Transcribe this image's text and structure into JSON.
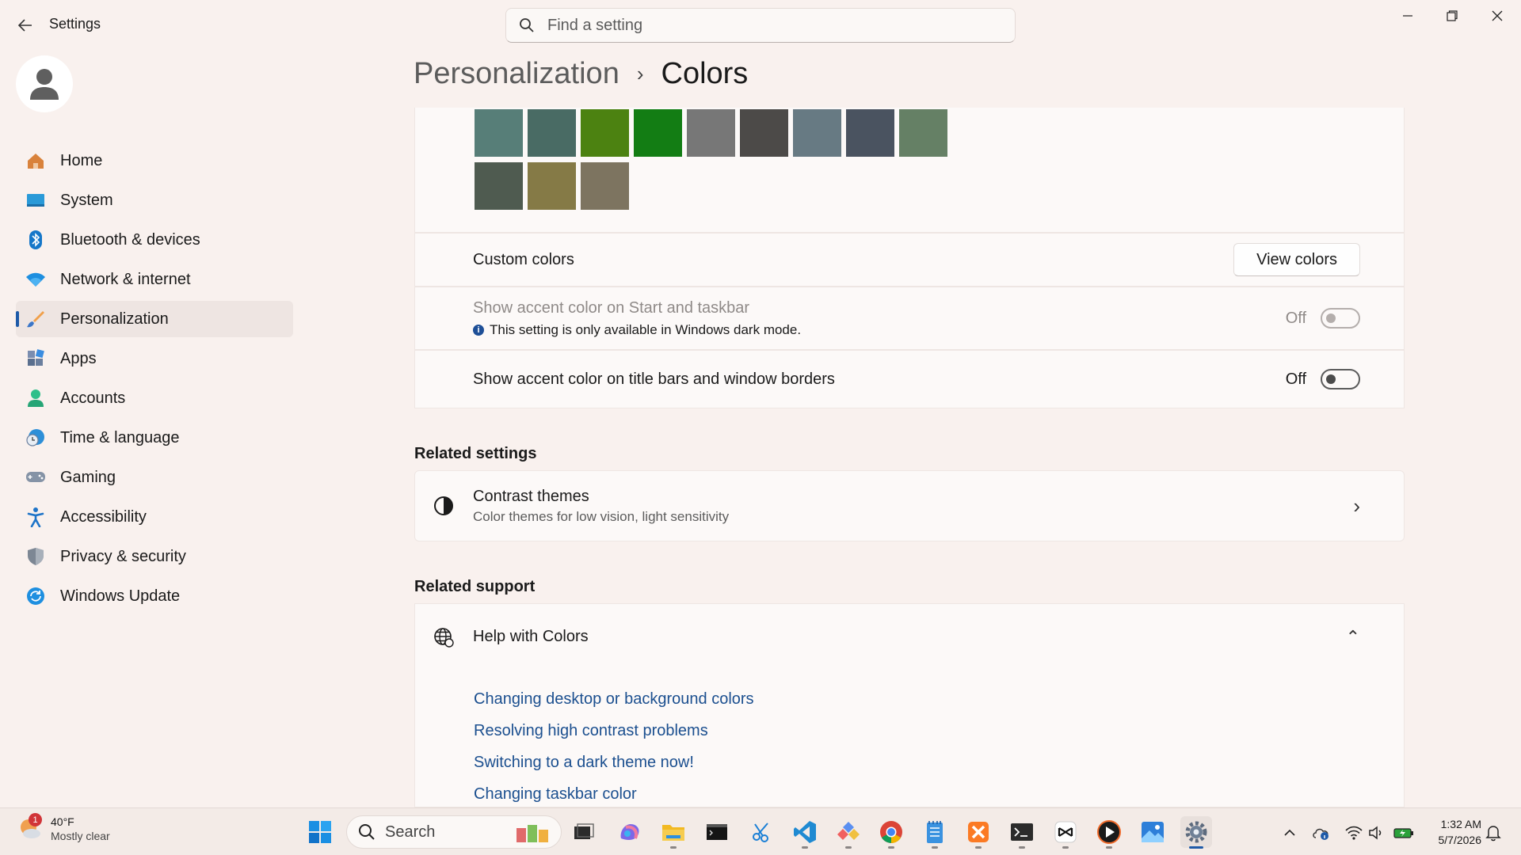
{
  "app": {
    "title": "Settings"
  },
  "search": {
    "placeholder": "Find a setting"
  },
  "window_controls": {
    "minimize": "—",
    "restore": "❐",
    "close": "✕"
  },
  "sidebar": {
    "items": [
      {
        "label": "Home",
        "icon": "home-icon"
      },
      {
        "label": "System",
        "icon": "system-icon"
      },
      {
        "label": "Bluetooth & devices",
        "icon": "bluetooth-icon"
      },
      {
        "label": "Network & internet",
        "icon": "wifi-icon"
      },
      {
        "label": "Personalization",
        "icon": "brush-icon",
        "active": true
      },
      {
        "label": "Apps",
        "icon": "apps-icon"
      },
      {
        "label": "Accounts",
        "icon": "accounts-icon"
      },
      {
        "label": "Time & language",
        "icon": "clock-globe-icon"
      },
      {
        "label": "Gaming",
        "icon": "gamepad-icon"
      },
      {
        "label": "Accessibility",
        "icon": "accessibility-icon"
      },
      {
        "label": "Privacy & security",
        "icon": "shield-icon"
      },
      {
        "label": "Windows Update",
        "icon": "update-icon"
      }
    ]
  },
  "header": {
    "parent": "Personalization",
    "separator": "›",
    "current": "Colors"
  },
  "swatches": {
    "row1": [
      "#577e78",
      "#496b64",
      "#4c8211",
      "#137d14",
      "#777777",
      "#4c4a48",
      "#677a83",
      "#4a5360",
      "#658065"
    ],
    "row2": [
      "#4f5b50",
      "#857a46",
      "#7d7460"
    ]
  },
  "custom_colors": {
    "label": "Custom colors",
    "button": "View colors"
  },
  "accent_start": {
    "label": "Show accent color on Start and taskbar",
    "note": "This setting is only available in Windows dark mode.",
    "state": "Off",
    "on": false,
    "disabled": true
  },
  "accent_titlebars": {
    "label": "Show accent color on title bars and window borders",
    "state": "Off",
    "on": false
  },
  "related_settings": {
    "title": "Related settings",
    "contrast": {
      "title": "Contrast themes",
      "subtitle": "Color themes for low vision, light sensitivity",
      "chevron": "›"
    }
  },
  "related_support": {
    "title": "Related support",
    "help_title": "Help with Colors",
    "chevron": "⌃",
    "links": [
      "Changing desktop or background colors",
      "Resolving high contrast problems",
      "Switching to a dark theme now!",
      "Changing taskbar color"
    ]
  },
  "taskbar": {
    "weather": {
      "temp": "40°F",
      "condition": "Mostly clear",
      "badge": "1"
    },
    "search_label": "Search",
    "apps": [
      "file-explorer-icon",
      "terminal-window-icon",
      "copilot-icon",
      "folder-icon",
      "command-prompt-icon",
      "snipping-tool-icon",
      "vscode-icon",
      "gem-app-icon",
      "chrome-icon",
      "notepad-icon",
      "xampp-icon",
      "terminal-icon",
      "capcut-icon",
      "media-player-icon",
      "photos-icon",
      "settings-gear-icon"
    ],
    "clock": {
      "time": "1:32 AM",
      "date": "5/7/2026"
    }
  },
  "colors": {
    "accent": "#1e5aa8",
    "link": "#1b4f8f"
  }
}
